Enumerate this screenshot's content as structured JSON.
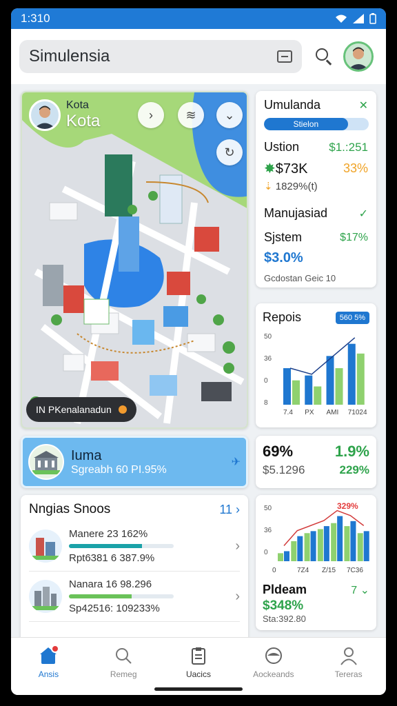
{
  "status": {
    "time": "1:310"
  },
  "appbar": {
    "search_text": "Simulensia"
  },
  "map": {
    "title_small": "Kota",
    "title_big": "Kota",
    "chip_label": "IN PKenalanadun",
    "colors": {
      "water": "#3f8ee0",
      "park": "#9ad26b",
      "road": "#e3e6ea",
      "block": "#f4f5f7"
    }
  },
  "summary": {
    "title": "Umulanda",
    "bar_label": "Stielon",
    "r1_label": "Ustion",
    "r1_value": "$1.:251",
    "r2_value": "$73K",
    "r2_pct": "33%",
    "r3_text": "1829%(t)",
    "r4_label": "Manujasiad",
    "r5_label": "Sjstem",
    "r5_pct": "$17%",
    "r6_value": "$3.0%",
    "footer": "Gcdostan Geic 10"
  },
  "reports": {
    "title": "Repois",
    "badge": "560 5%",
    "chart_data": {
      "type": "bar",
      "categories": [
        "7.4",
        "PX",
        "AMI",
        "71024"
      ],
      "ylabels": [
        "50",
        "36",
        "0",
        "8"
      ],
      "series": [
        {
          "values": [
            30,
            24,
            40,
            50
          ]
        },
        {
          "values": [
            20,
            15,
            30,
            42
          ]
        }
      ],
      "trend": [
        30,
        25,
        40,
        55
      ]
    }
  },
  "featured": {
    "title": "Iuma",
    "subtitle": "Sgreabh 60 PI.95%"
  },
  "stats": {
    "v1": "69%",
    "v2": "1.9%",
    "v3": "$5.1296",
    "v4": "229%"
  },
  "list": {
    "title": "Nngias Snoos",
    "count": "11",
    "items": [
      {
        "line1": "Manere 23 162%",
        "line2": "Rpt6381 6 387.9%",
        "progress": 0.7
      },
      {
        "line1": "Nanara 16 98.296",
        "line2": "Sp42516: 109233%",
        "progress": 0.6
      }
    ]
  },
  "chart2": {
    "top_right": "329%",
    "title": "Pldeam",
    "badge": "7",
    "value": "$348%",
    "sub": "Sta:392.80",
    "chart_data": {
      "type": "bar",
      "categories": [
        "0",
        "7Z4",
        "Z/15",
        "7C36"
      ],
      "ylabels": [
        "50",
        "36",
        "0"
      ],
      "series": [
        {
          "values": [
            10,
            25,
            30,
            35,
            45,
            40,
            30
          ]
        },
        {
          "values": [
            8,
            20,
            28,
            32,
            38,
            35,
            28
          ]
        }
      ]
    }
  },
  "nav": {
    "items": [
      {
        "label": "Ansis"
      },
      {
        "label": "Remeg"
      },
      {
        "label": "Uacics"
      },
      {
        "label": "Aockeands"
      },
      {
        "label": "Tereras"
      }
    ]
  }
}
